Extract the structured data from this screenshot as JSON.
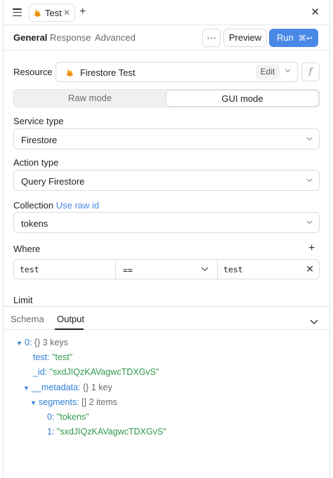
{
  "tabbar": {
    "tab_label": "Test",
    "close_symbol": "✕",
    "add_symbol": "+",
    "window_close_symbol": "✕"
  },
  "subbar": {
    "tabs": [
      "General",
      "Response",
      "Advanced"
    ],
    "more_label": "···",
    "preview_label": "Preview",
    "run_label": "Run",
    "run_shortcut": "⌘↩"
  },
  "resource": {
    "label": "Resource",
    "value": "Firestore Test",
    "edit_label": "Edit",
    "fx_label": "f"
  },
  "mode": {
    "options": [
      "Raw mode",
      "GUI mode"
    ],
    "selected": "GUI mode"
  },
  "service_type": {
    "label": "Service type",
    "value": "Firestore"
  },
  "action_type": {
    "label": "Action type",
    "value": "Query Firestore"
  },
  "collection": {
    "label": "Collection",
    "link": "Use raw id",
    "value": "tokens"
  },
  "where": {
    "label": "Where",
    "add_symbol": "+",
    "field": "test",
    "operator": "==",
    "value": "test",
    "clear_symbol": "✕"
  },
  "limit": {
    "label": "Limit"
  },
  "output_panel": {
    "tabs": [
      "Schema",
      "Output"
    ],
    "active_tab": "Output"
  },
  "tree": {
    "root_key": "0:",
    "root_type": "{}",
    "root_count": "3 keys",
    "test_key": "test:",
    "test_val": "\"test\"",
    "id_key": "_id:",
    "id_val": "\"sxdJIQzKAVagwcTDXGvS\"",
    "metadata_key": "__metadata:",
    "metadata_type": "{}",
    "metadata_count": "1 key",
    "segments_key": "segments:",
    "segments_type": "[]",
    "segments_count": "2 items",
    "seg0_key": "0:",
    "seg0_val": "\"tokens\"",
    "seg1_key": "1:",
    "seg1_val": "\"sxdJIQzKAVagwcTDXGvS\""
  },
  "colors": {
    "accent": "#4a88e6",
    "key": "#2f7fd6",
    "string": "#2f9a4a",
    "firebase_orange": "#f6a21b"
  },
  "icons": {
    "menu": "hamburger-icon",
    "firebase": "firebase-icon",
    "chevron": "chevron-down-icon",
    "triangle": "triangle-down-icon"
  }
}
